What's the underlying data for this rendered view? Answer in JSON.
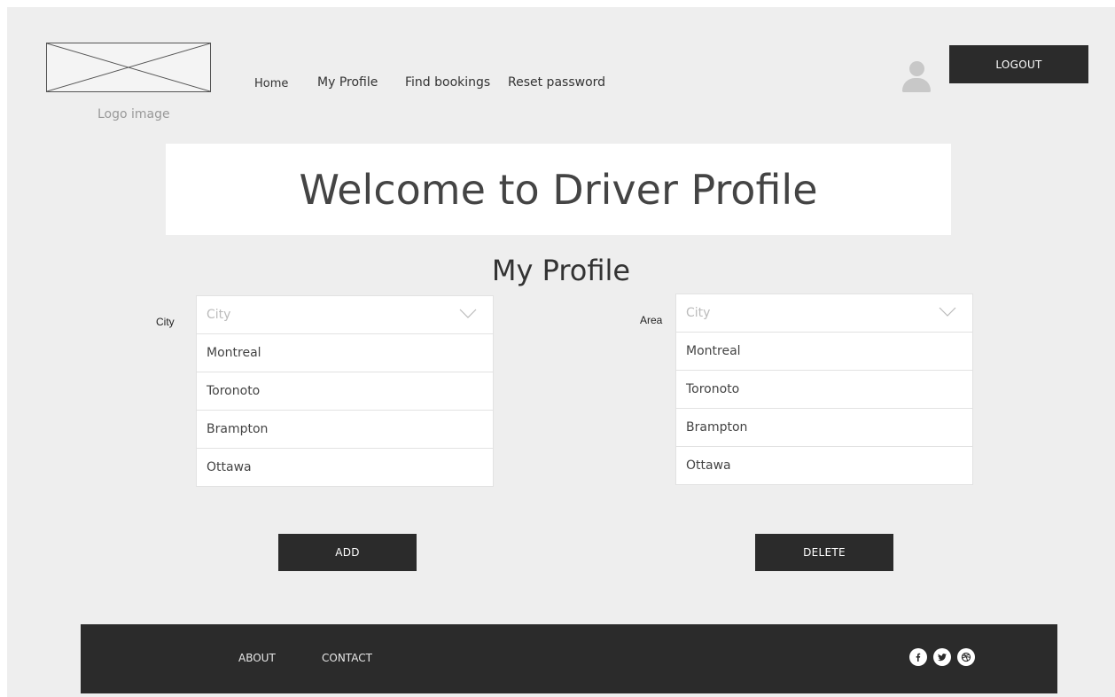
{
  "header": {
    "logo_caption": "Logo image",
    "nav": [
      {
        "label": "Home"
      },
      {
        "label": "My Profile"
      },
      {
        "label": "Find bookings"
      },
      {
        "label": "Reset password"
      }
    ],
    "logout_label": "LOGOUT"
  },
  "banner": {
    "title": "Welcome to Driver Profile"
  },
  "main": {
    "section_title": "My Profile",
    "city": {
      "label": "City",
      "placeholder": "City",
      "options": [
        "Montreal",
        "Toronoto",
        "Brampton",
        "Ottawa"
      ]
    },
    "area": {
      "label": "Area",
      "placeholder": "City",
      "options": [
        "Montreal",
        "Toronoto",
        "Brampton",
        "Ottawa"
      ]
    },
    "add_label": "ADD",
    "delete_label": "DELETE"
  },
  "footer": {
    "links": [
      {
        "label": "ABOUT"
      },
      {
        "label": "CONTACT"
      }
    ],
    "social": [
      "facebook-icon",
      "twitter-icon",
      "dribbble-icon"
    ]
  },
  "colors": {
    "background": "#eeeeee",
    "dark": "#2b2b2b",
    "panel": "#ffffff"
  }
}
